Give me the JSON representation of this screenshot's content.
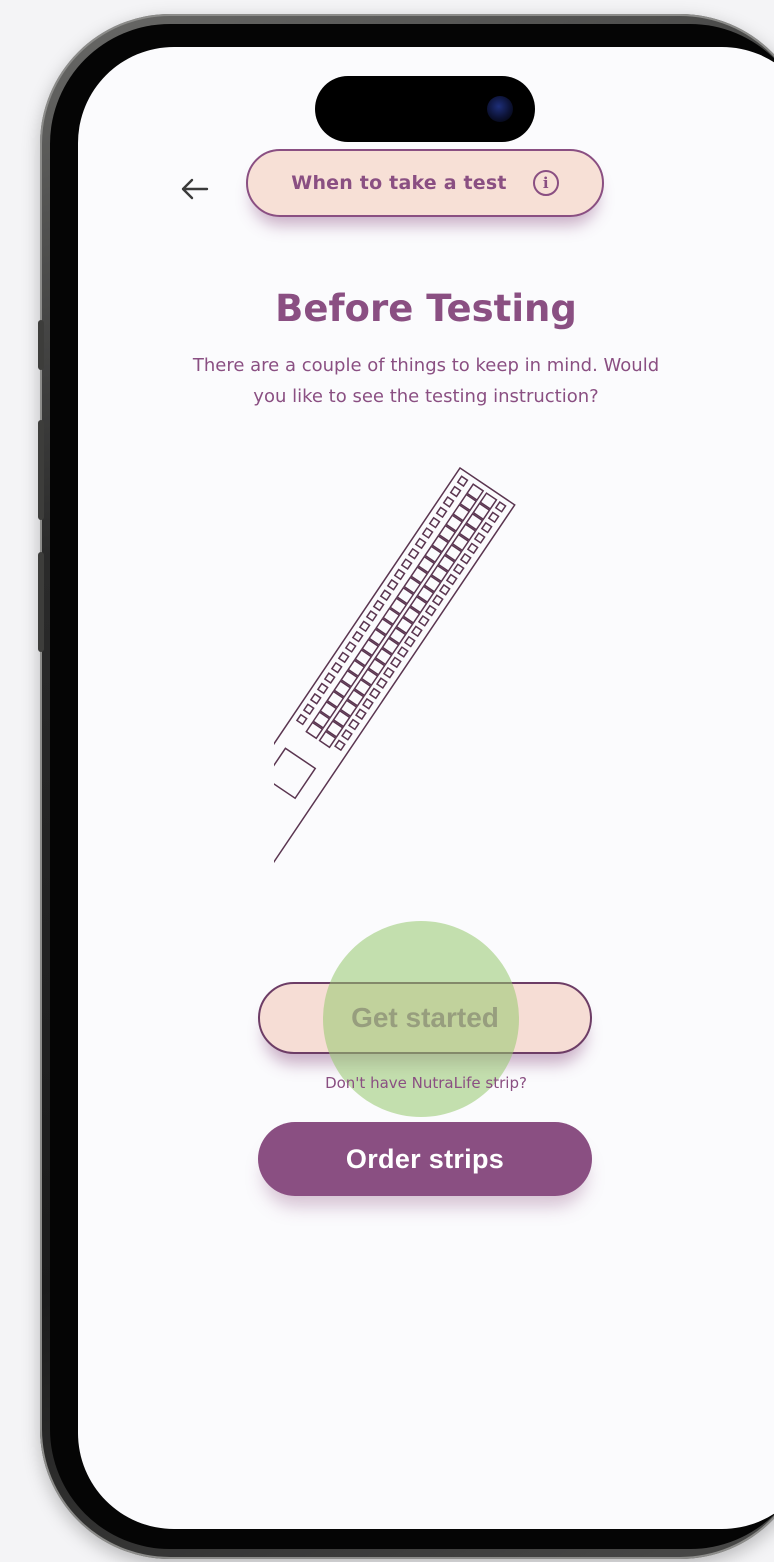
{
  "header": {
    "back_icon": "arrow-left-icon",
    "info_pill_label": "When to take a test",
    "info_icon": "info-circle-icon",
    "info_glyph": "i"
  },
  "main": {
    "title": "Before Testing",
    "subtitle": "There are a couple of things to keep in mind. Would you like to see the testing instruction?",
    "illustration": "test-strip-illustration",
    "get_started_label": "Get started",
    "helper_text": "Don't have NutraLife strip?",
    "order_label": "Order strips"
  },
  "colors": {
    "accent": "#8a4f82",
    "pill_background": "#f7e0d6",
    "screen_background": "#fbfbfd",
    "touch_indicator": "#96c86e"
  }
}
